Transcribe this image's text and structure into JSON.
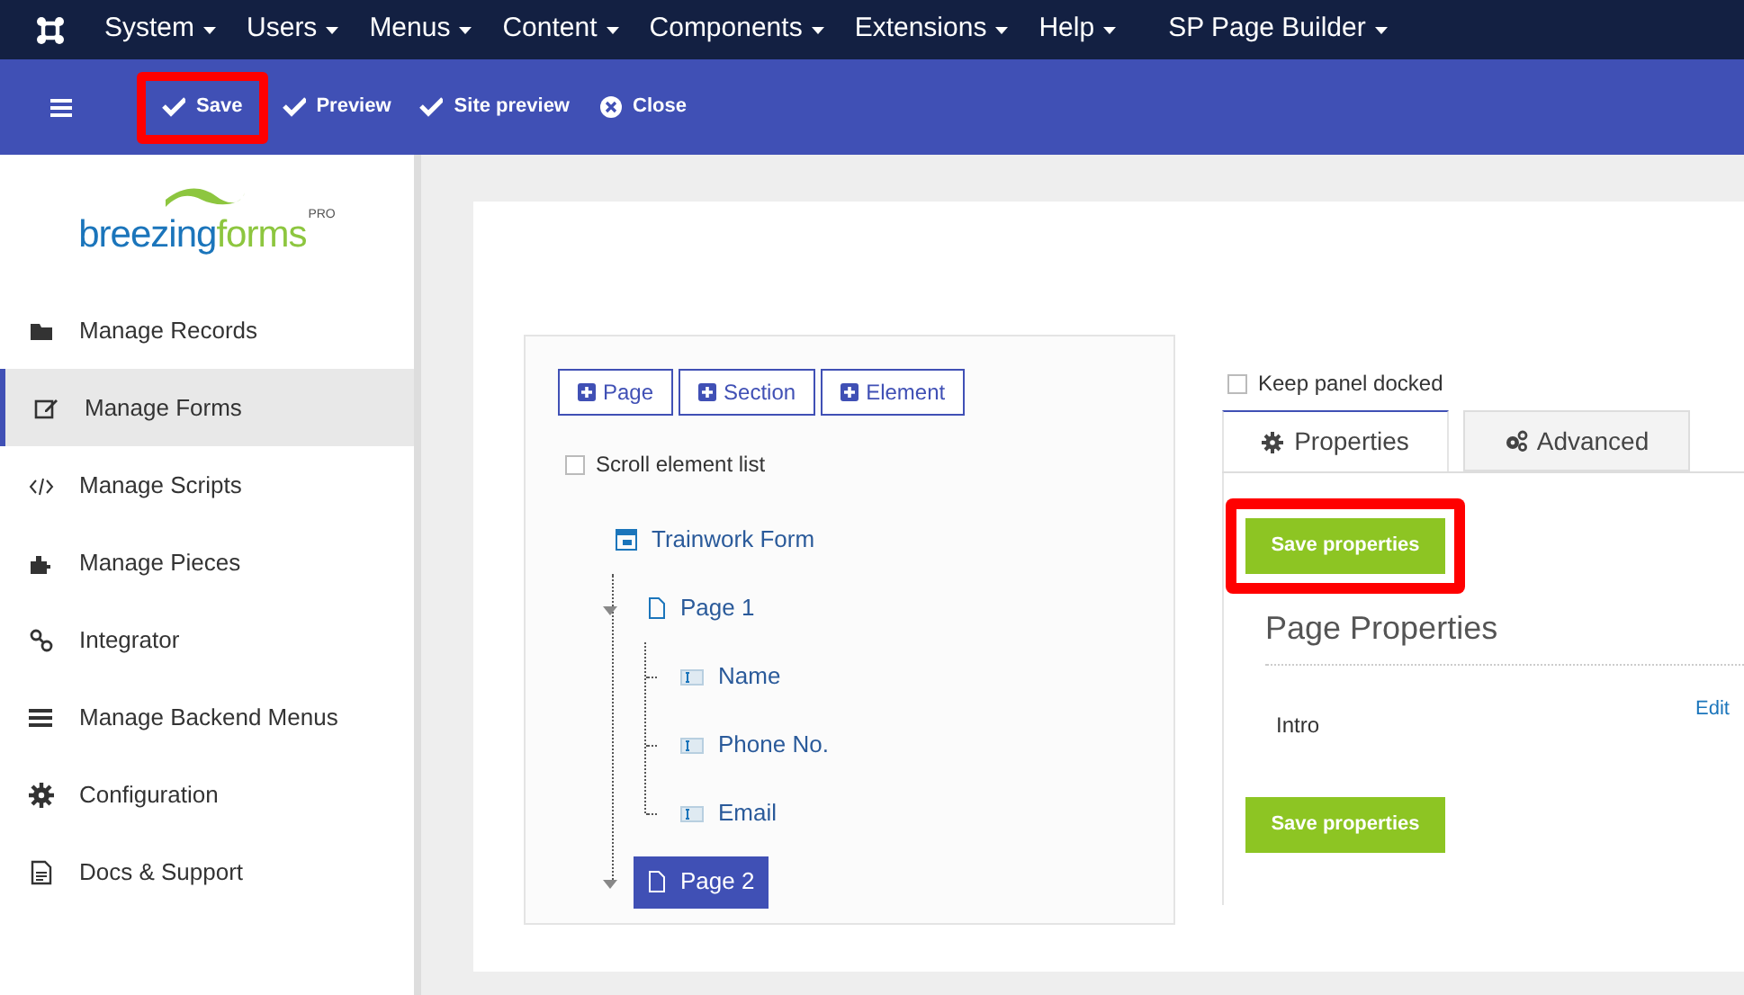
{
  "top_menu": [
    {
      "label": "System"
    },
    {
      "label": "Users"
    },
    {
      "label": "Menus"
    },
    {
      "label": "Content"
    },
    {
      "label": "Components"
    },
    {
      "label": "Extensions"
    },
    {
      "label": "Help"
    },
    {
      "label": "SP Page Builder"
    }
  ],
  "toolbar": [
    {
      "label": "Save",
      "kind": "check",
      "highlighted": true
    },
    {
      "label": "Preview",
      "kind": "check",
      "highlighted": false
    },
    {
      "label": "Site preview",
      "kind": "check",
      "highlighted": false
    },
    {
      "label": "Close",
      "kind": "close",
      "highlighted": false
    }
  ],
  "logo": {
    "brand_1": "breezing",
    "brand_2": "forms",
    "badge": "PRO"
  },
  "sidebar": {
    "items": [
      {
        "label": "Manage Records",
        "kind": "folder",
        "selected": false
      },
      {
        "label": "Manage Forms",
        "kind": "edit",
        "selected": true
      },
      {
        "label": "Manage Scripts",
        "kind": "code",
        "selected": false
      },
      {
        "label": "Manage Pieces",
        "kind": "puzzle",
        "selected": false
      },
      {
        "label": "Integrator",
        "kind": "link",
        "selected": false
      },
      {
        "label": "Manage Backend Menus",
        "kind": "bars",
        "selected": false
      },
      {
        "label": "Configuration",
        "kind": "gear",
        "selected": false
      },
      {
        "label": "Docs & Support",
        "kind": "doc",
        "selected": false
      }
    ]
  },
  "add_buttons": [
    {
      "label": "Page"
    },
    {
      "label": "Section"
    },
    {
      "label": "Element"
    }
  ],
  "scroll_option": {
    "label": "Scroll element list",
    "checked": false
  },
  "tree": {
    "label": "Trainwork Form",
    "kind": "form",
    "selected": false,
    "children": [
      {
        "label": "Page 1",
        "kind": "page",
        "selected": false,
        "children": [
          {
            "label": "Name",
            "kind": "field",
            "selected": false
          },
          {
            "label": "Phone No.",
            "kind": "field",
            "selected": false
          },
          {
            "label": "Email",
            "kind": "field",
            "selected": false
          }
        ]
      },
      {
        "label": "Page 2",
        "kind": "page",
        "selected": true
      }
    ]
  },
  "dock_option": {
    "label": "Keep panel docked",
    "checked": false
  },
  "tabs": [
    {
      "label": "Properties",
      "kind": "gear",
      "selected": true
    },
    {
      "label": "Advanced",
      "kind": "gears",
      "selected": false
    }
  ],
  "panel": {
    "save_top": {
      "label": "Save properties",
      "highlighted": true
    },
    "heading": "Page Properties",
    "rows": [
      {
        "label": "Intro",
        "action": "Edit"
      }
    ],
    "save_bottom": {
      "label": "Save properties",
      "highlighted": false
    }
  }
}
